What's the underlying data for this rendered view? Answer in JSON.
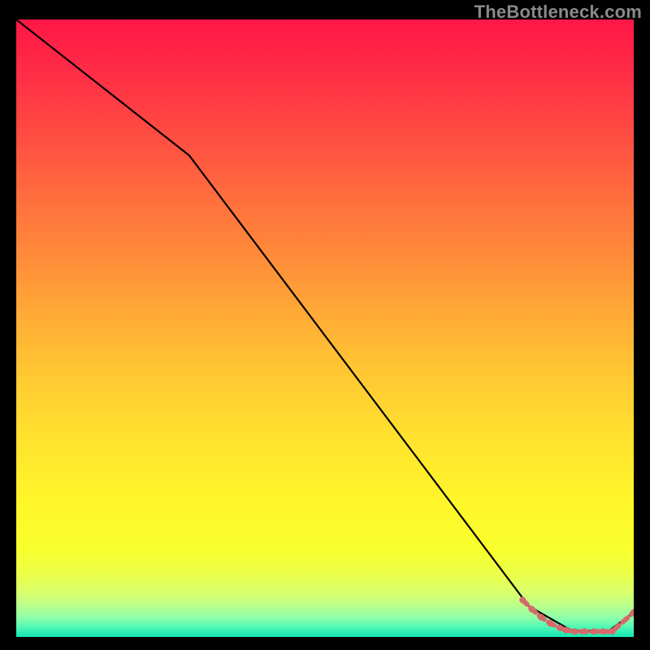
{
  "watermark": "TheBottleneck.com",
  "chart_data": {
    "type": "line",
    "title": "",
    "xlabel": "",
    "ylabel": "",
    "xlim": [
      0,
      100
    ],
    "ylim": [
      0,
      100
    ],
    "series": [
      {
        "name": "curve",
        "color": "#000000",
        "x": [
          0,
          28,
          83,
          90,
          96,
          100
        ],
        "y": [
          100,
          78,
          5,
          1,
          1,
          4
        ]
      }
    ],
    "markers": [
      {
        "name": "marker-cluster",
        "color": "#d66a6a",
        "points": [
          {
            "x": 82,
            "y": 6
          },
          {
            "x": 83.5,
            "y": 4.5
          },
          {
            "x": 85,
            "y": 3.2
          },
          {
            "x": 86.5,
            "y": 2.2
          },
          {
            "x": 88,
            "y": 1.5
          },
          {
            "x": 89,
            "y": 1.1
          },
          {
            "x": 90.5,
            "y": 0.9
          },
          {
            "x": 92,
            "y": 0.9
          },
          {
            "x": 93.5,
            "y": 0.9
          },
          {
            "x": 95,
            "y": 0.9
          },
          {
            "x": 96.5,
            "y": 0.9
          },
          {
            "x": 100,
            "y": 4
          }
        ]
      }
    ]
  },
  "colors": {
    "marker": "#d66a6a",
    "line": "#000000"
  }
}
